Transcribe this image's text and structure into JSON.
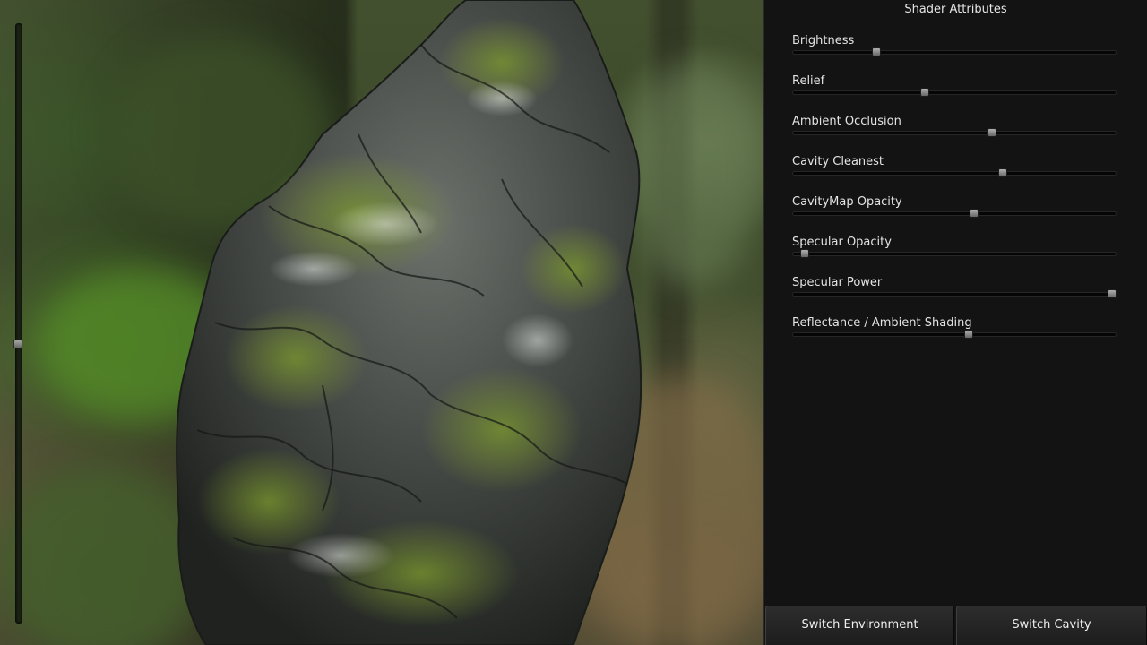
{
  "panel": {
    "title": "Shader Attributes",
    "attributes": [
      {
        "label": "Brightness",
        "value": 0.26
      },
      {
        "label": "Relief",
        "value": 0.41
      },
      {
        "label": "Ambient Occlusion",
        "value": 0.615
      },
      {
        "label": "Cavity Cleanest",
        "value": 0.65
      },
      {
        "label": "CavityMap Opacity",
        "value": 0.56
      },
      {
        "label": "Specular Opacity",
        "value": 0.04
      },
      {
        "label": "Specular Power",
        "value": 0.985
      },
      {
        "label": "Reflectance / Ambient Shading",
        "value": 0.545
      }
    ]
  },
  "buttons": {
    "switch_environment": "Switch Environment",
    "switch_cavity": "Switch Cavity"
  },
  "viewport": {
    "vertical_slider_value": 0.535
  },
  "colors": {
    "panel_bg": "#121312",
    "rock_base": "#3a3d3a",
    "moss": "#6a8a2a"
  }
}
